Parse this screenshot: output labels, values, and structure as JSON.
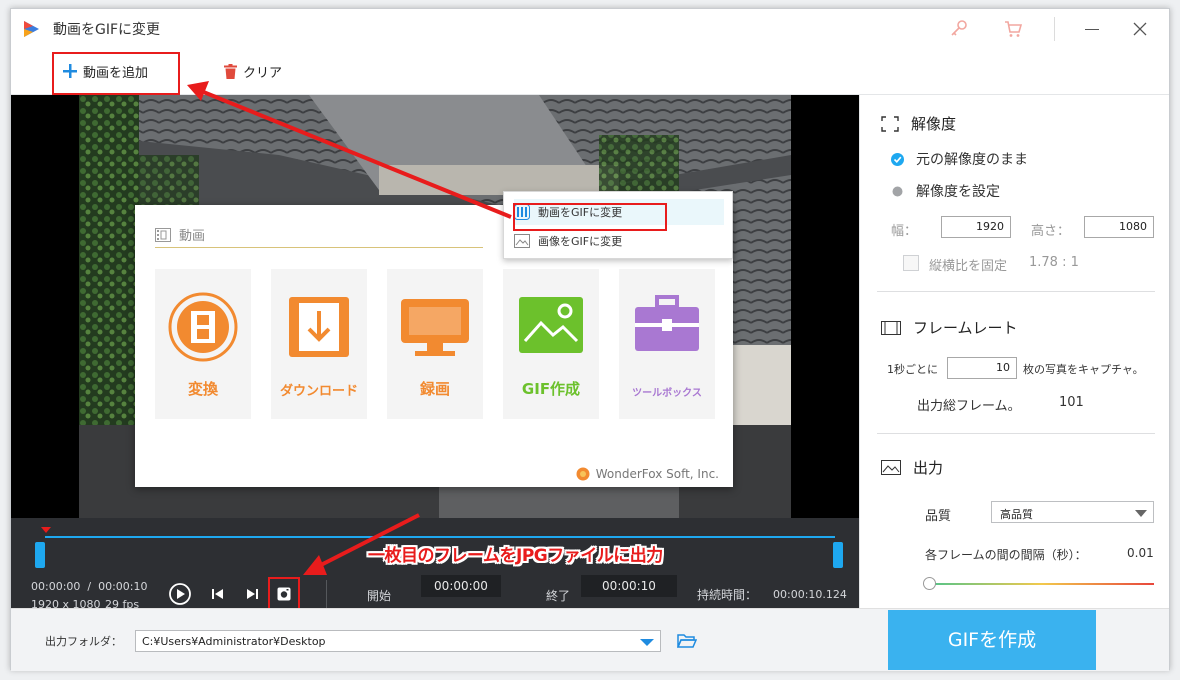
{
  "window": {
    "title": "動画をGIFに変更"
  },
  "toolbar": {
    "add_video": "動画を追加",
    "clear": "クリア"
  },
  "panel": {
    "section_label": "動画",
    "cards": [
      {
        "label": "変換",
        "icon": "film-convert-icon",
        "color": "#f28a30"
      },
      {
        "label": "ダウンロード",
        "icon": "download-icon",
        "color": "#f28a30"
      },
      {
        "label": "録画",
        "icon": "screen-record-icon",
        "color": "#f28a30"
      },
      {
        "label": "GIF作成",
        "icon": "image-gif-icon",
        "color": "#6cc12c"
      },
      {
        "label": "ツールボックス",
        "icon": "toolbox-icon",
        "color": "#a978d2"
      }
    ],
    "brand": "WonderFox Soft, Inc."
  },
  "dropdown": {
    "items": [
      "動画をGIFに変更",
      "画像をGIFに変更"
    ]
  },
  "annotation": {
    "text": "一枚目のフレームをJPGファイルに出力"
  },
  "player": {
    "time": "00:00:00  /  00:00:10",
    "resolution": "1920 x 1080",
    "fps": "29 fps",
    "start_label": "開始",
    "start_value": "00:00:00",
    "end_label": "終了",
    "end_value": "00:00:10",
    "duration_label": "持続時間：",
    "duration_value": "00:00:10.124"
  },
  "settings": {
    "resolution_title": "解像度",
    "keep_original": "元の解像度のまま",
    "set_resolution": "解像度を設定",
    "width_label": "幅：",
    "width_value": "1920",
    "height_label": "高さ：",
    "height_value": "1080",
    "lock_ratio": "縦横比を固定",
    "ratio_value": "1.78 : 1",
    "framerate_title": "フレームレート",
    "capture_prefix": "1秒ごとに",
    "capture_value": "10",
    "capture_suffix": "枚の写真をキャプチャ。",
    "total_frames_label": "出力総フレーム。",
    "total_frames_value": "101",
    "output_title": "出力",
    "quality_label": "品質",
    "quality_value": "高品質",
    "interval_label": "各フレームの間の間隔（秒）：",
    "interval_value": "0.01"
  },
  "bottom": {
    "folder_label": "出力フォルダ：",
    "folder_value": "C:¥Users¥Administrator¥Desktop",
    "create_button": "GIFを作成"
  },
  "colors": {
    "accent": "#1ea8f0",
    "annotation_red": "#e81c1c",
    "create_button": "#3ab2ef"
  }
}
